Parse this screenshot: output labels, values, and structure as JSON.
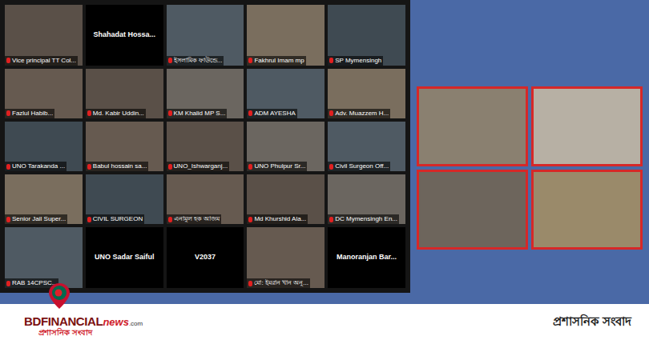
{
  "meeting": {
    "tiles": [
      {
        "name": "Vice principal TT Col...",
        "kind": "video",
        "muted": true
      },
      {
        "name": "Shahadat Hossa...",
        "kind": "name-only",
        "muted": false
      },
      {
        "name": "ইসলামিক ফাউন্ডে...",
        "kind": "video",
        "muted": true
      },
      {
        "name": "Fakhrul Imam mp",
        "kind": "video",
        "muted": true
      },
      {
        "name": "SP Mymensingh",
        "kind": "video",
        "muted": true
      },
      {
        "name": "Fazlul Habib...",
        "kind": "video",
        "muted": true
      },
      {
        "name": "Md. Kabir Uddin...",
        "kind": "video",
        "muted": true
      },
      {
        "name": "KM Khalid MP S...",
        "kind": "video",
        "muted": true
      },
      {
        "name": "ADM AYESHA",
        "kind": "video",
        "muted": true
      },
      {
        "name": "Adv. Muazzem H...",
        "kind": "video",
        "muted": true
      },
      {
        "name": "UNO Tarakanda ...",
        "kind": "video",
        "muted": true
      },
      {
        "name": "Babul hossain sa...",
        "kind": "video",
        "muted": true
      },
      {
        "name": "UNO_Ishwarganj...",
        "kind": "video",
        "muted": true
      },
      {
        "name": "UNO Phulpur Sr...",
        "kind": "video",
        "muted": true
      },
      {
        "name": "Civil Surgeon Off...",
        "kind": "video",
        "muted": true
      },
      {
        "name": "Senior Jail Super...",
        "kind": "video",
        "muted": true
      },
      {
        "name": "CIVIL SURGEON",
        "kind": "video",
        "muted": true
      },
      {
        "name": "এনামুল হক আজম",
        "kind": "video",
        "muted": true
      },
      {
        "name": "Md Khurshid Ala...",
        "kind": "video",
        "muted": true
      },
      {
        "name": "DC Mymensingh En...",
        "kind": "video",
        "muted": true
      },
      {
        "name": "RAB 14CPSC...",
        "kind": "video",
        "muted": true
      },
      {
        "name": "UNO Sadar Saiful",
        "kind": "name-only",
        "muted": false
      },
      {
        "name": "V2037",
        "kind": "name-only",
        "muted": false
      },
      {
        "name": "মো: ইমরান খান অনু...",
        "kind": "video",
        "muted": true
      },
      {
        "name": "Manoranjan Bar...",
        "kind": "name-only",
        "muted": false
      }
    ]
  },
  "featured": [
    {
      "highlighted": true
    },
    {
      "highlighted": true
    },
    {
      "highlighted": true
    },
    {
      "highlighted": true
    }
  ],
  "banner": {
    "brand": "BDFINANCIAL",
    "news": "news",
    "domain": ".com",
    "tagline": "প্রশাসনিক সংবাদ",
    "category": "প্রশাসনিক সংবাদ"
  }
}
